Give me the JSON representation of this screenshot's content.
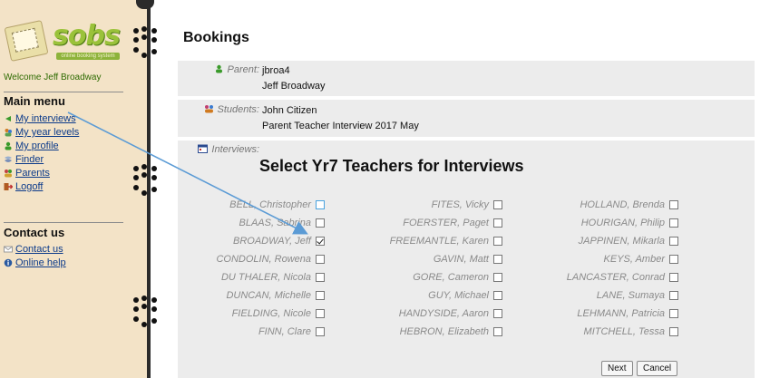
{
  "sidebar": {
    "brand": "sobs",
    "tagline": "online booking system",
    "welcome": "Welcome Jeff Broadway",
    "main_menu_heading": "Main menu",
    "main_menu": [
      {
        "label": "My interviews",
        "icon": "green-arrow-icon"
      },
      {
        "label": "My year levels",
        "icon": "people-icon"
      },
      {
        "label": "My profile",
        "icon": "person-icon"
      },
      {
        "label": "Finder",
        "icon": "finder-icon"
      },
      {
        "label": "Parents",
        "icon": "parents-icon"
      },
      {
        "label": "Logoff",
        "icon": "logoff-icon"
      }
    ],
    "contact_heading": "Contact us",
    "contact_menu": [
      {
        "label": "Contact us",
        "icon": "envelope-icon"
      },
      {
        "label": "Online help",
        "icon": "help-icon"
      }
    ]
  },
  "main": {
    "title": "Bookings",
    "parent": {
      "label": "Parent:",
      "username": "jbroa4",
      "name": "Jeff Broadway"
    },
    "students": {
      "label": "Students:",
      "student": "John Citizen",
      "event": "Parent Teacher Interview 2017 May"
    },
    "interviews": {
      "label": "Interviews:"
    },
    "heading": "Select Yr7 Teachers for Interviews",
    "teachers": [
      [
        {
          "name": "BELL, Christopher",
          "checked": false,
          "highlight": true
        },
        {
          "name": "BLAAS, Sabrina",
          "checked": false
        },
        {
          "name": "BROADWAY, Jeff",
          "checked": true
        },
        {
          "name": "CONDOLIN, Rowena",
          "checked": false
        },
        {
          "name": "DU THALER, Nicola",
          "checked": false
        },
        {
          "name": "DUNCAN, Michelle",
          "checked": false
        },
        {
          "name": "FIELDING, Nicole",
          "checked": false
        },
        {
          "name": "FINN, Clare",
          "checked": false
        }
      ],
      [
        {
          "name": "FITES, Vicky",
          "checked": false
        },
        {
          "name": "FOERSTER, Paget",
          "checked": false
        },
        {
          "name": "FREEMANTLE, Karen",
          "checked": false
        },
        {
          "name": "GAVIN, Matt",
          "checked": false
        },
        {
          "name": "GORE, Cameron",
          "checked": false
        },
        {
          "name": "GUY, Michael",
          "checked": false
        },
        {
          "name": "HANDYSIDE, Aaron",
          "checked": false
        },
        {
          "name": "HEBRON, Elizabeth",
          "checked": false
        }
      ],
      [
        {
          "name": "HOLLAND, Brenda",
          "checked": false
        },
        {
          "name": "HOURIGAN, Philip",
          "checked": false
        },
        {
          "name": "JAPPINEN, Mikarla",
          "checked": false
        },
        {
          "name": "KEYS, Amber",
          "checked": false
        },
        {
          "name": "LANCASTER, Conrad",
          "checked": false
        },
        {
          "name": "LANE, Sumaya",
          "checked": false
        },
        {
          "name": "LEHMANN, Patricia",
          "checked": false
        },
        {
          "name": "MITCHELL, Tessa",
          "checked": false
        }
      ]
    ],
    "buttons": {
      "next": "Next",
      "cancel": "Cancel"
    }
  },
  "colors": {
    "sidebar_bg": "#f3e3c7",
    "link": "#0b3a8a",
    "row_bg": "#ececec",
    "annotation_arrow": "#5b9bd5"
  }
}
